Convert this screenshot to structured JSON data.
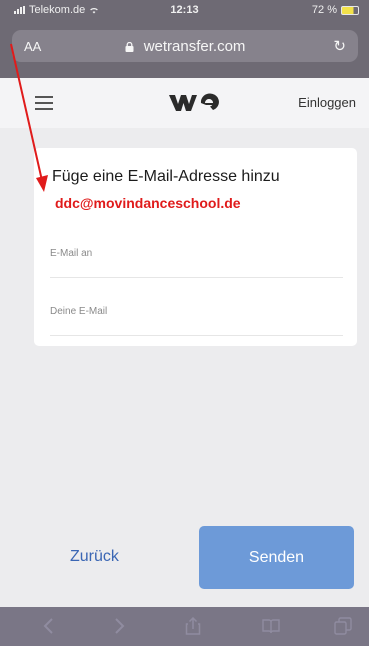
{
  "status_bar": {
    "carrier": "Telekom.de",
    "time": "12:13",
    "battery": "72 %",
    "battery_level_percent": 72,
    "battery_color": "#f3e24a"
  },
  "browser": {
    "text_size_label": "AA",
    "url": "wetransfer.com",
    "icons": [
      "wifi-icon",
      "lock-icon",
      "reload-icon",
      "back-icon",
      "forward-icon",
      "share-icon",
      "bookmarks-icon",
      "tabs-icon"
    ]
  },
  "header": {
    "login_label": "Einloggen",
    "logo_alt": "we"
  },
  "card": {
    "title": "Füge eine E-Mail-Adresse hinzu",
    "recipient_placeholder": "E-Mail an",
    "sender_placeholder": "Deine E-Mail"
  },
  "annotation": {
    "text": "ddc@movindanceschool.de",
    "color": "#e01b1b"
  },
  "actions": {
    "back_label": "Zurück",
    "send_label": "Senden",
    "send_color": "#6d9ad8",
    "back_color": "#3a66b4"
  }
}
